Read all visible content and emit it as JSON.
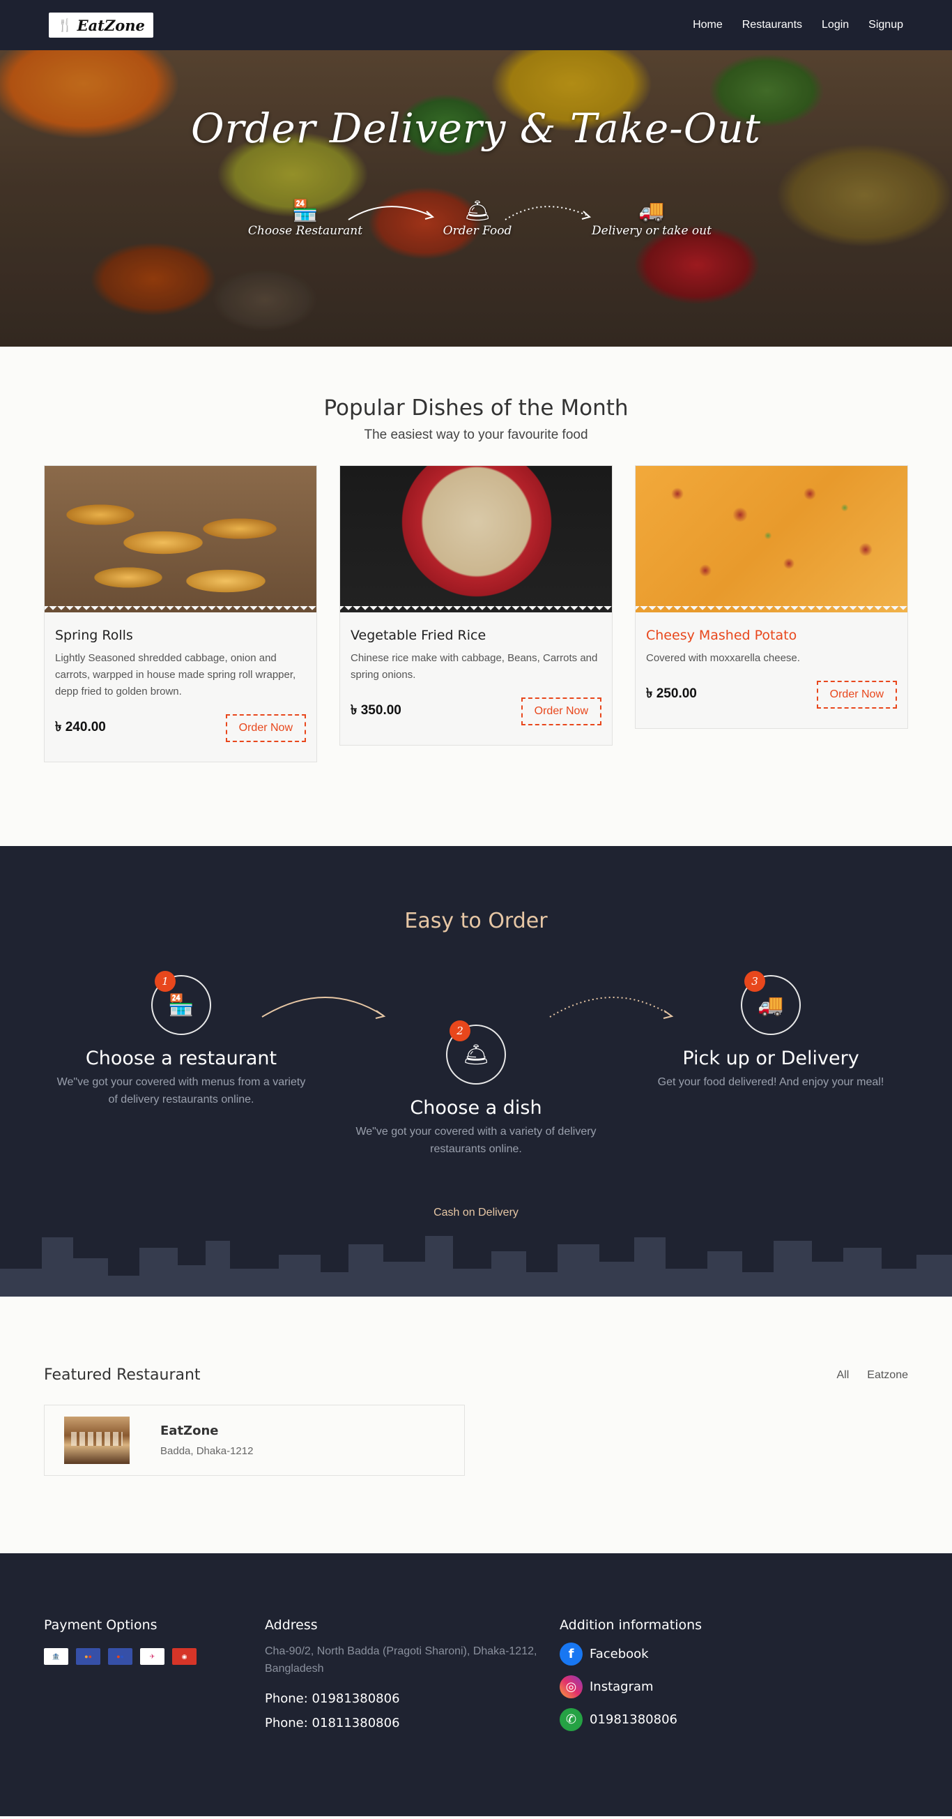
{
  "nav": {
    "logo_text": "EatZone",
    "links": [
      "Home",
      "Restaurants",
      "Login",
      "Signup"
    ]
  },
  "hero": {
    "title": "Order Delivery & Take-Out",
    "steps": [
      "Choose Restaurant",
      "Order Food",
      "Delivery or take out"
    ]
  },
  "popular": {
    "title": "Popular Dishes of the Month",
    "subtitle": "The easiest way to your favourite food",
    "dishes": [
      {
        "name": "Spring Rolls",
        "description": "Lightly Seasoned shredded cabbage, onion and carrots, warpped in house made spring roll wrapper, depp fried to golden brown.",
        "price": "৳ 240.00",
        "button": "Order Now"
      },
      {
        "name": "Vegetable Fried Rice",
        "description": "Chinese rice make with cabbage, Beans, Carrots and spring onions.",
        "price": "৳ 350.00",
        "button": "Order Now"
      },
      {
        "name": "Cheesy Mashed Potato",
        "description": "Covered with moxxarella cheese.",
        "price": "৳ 250.00",
        "button": "Order Now"
      }
    ]
  },
  "easy": {
    "title": "Easy to Order",
    "steps": [
      {
        "number": "1",
        "title": "Choose a restaurant",
        "description": "We\"ve got your covered with menus from a variety of delivery restaurants online."
      },
      {
        "number": "2",
        "title": "Choose a dish",
        "description": "We\"ve got your covered with a variety of delivery restaurants online."
      },
      {
        "number": "3",
        "title": "Pick up or Delivery",
        "description": "Get your food delivered! And enjoy your meal!"
      }
    ],
    "cod": "Cash on Delivery"
  },
  "featured": {
    "title": "Featured Restaurant",
    "filters": [
      "All",
      "Eatzone"
    ],
    "restaurant": {
      "name": "EatZone",
      "address": "Badda, Dhaka-1212"
    }
  },
  "footer": {
    "payment_title": "Payment Options",
    "address_title": "Address",
    "address": "Cha-90/2, North Badda (Pragoti Sharoni), Dhaka-1212, Bangladesh",
    "phones": [
      "Phone: 01981380806",
      "Phone: 01811380806"
    ],
    "info_title": "Addition informations",
    "social": [
      "Facebook",
      "Instagram",
      "01981380806"
    ]
  },
  "colors": {
    "accent": "#e8471c",
    "dark": "#1f2331",
    "gold": "#e7c7a5"
  }
}
